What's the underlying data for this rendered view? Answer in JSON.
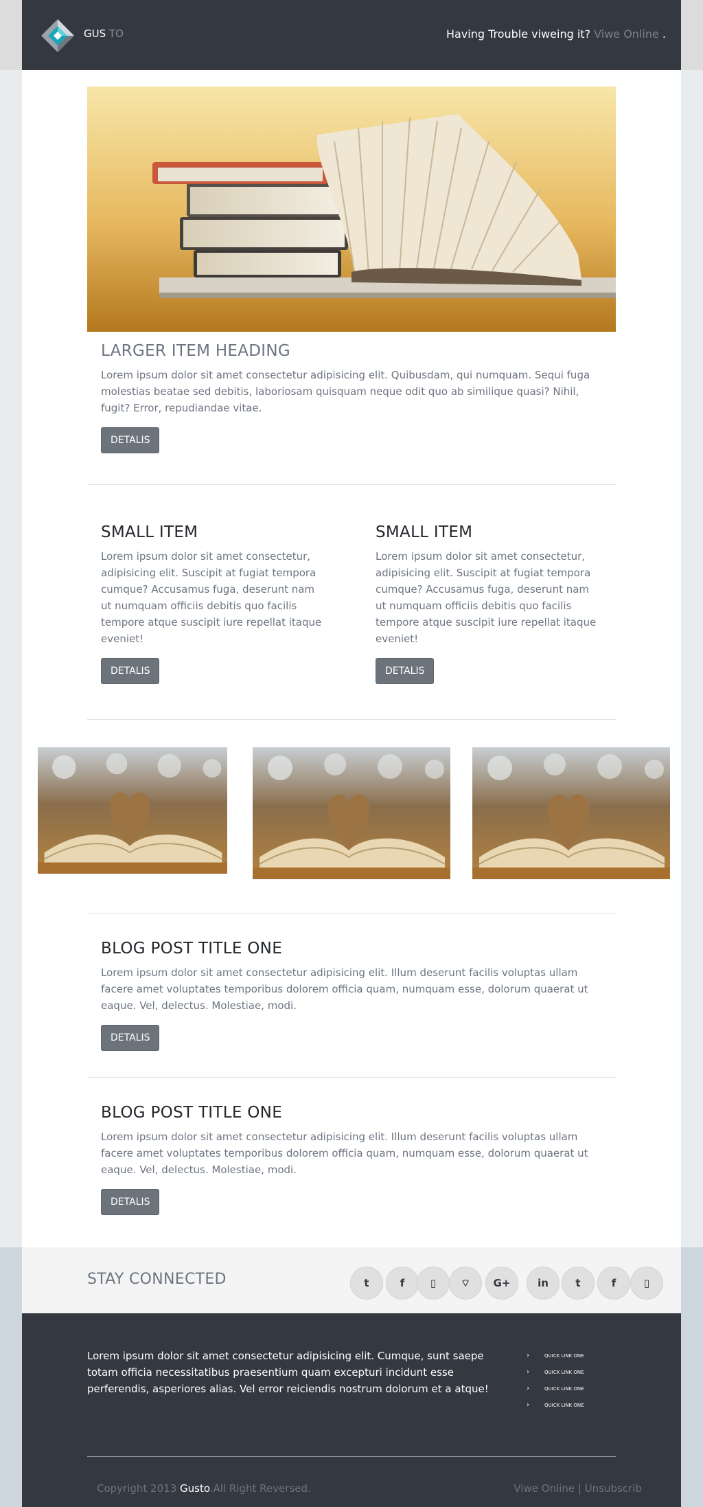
{
  "header": {
    "brand_main": "GUS",
    "brand_sub": "TO",
    "trouble_text": "Having Trouble viweing it? ",
    "view_online": "Viwe Online",
    "trouble_end": " ."
  },
  "hero": {
    "heading": "LARGER ITEM HEADING",
    "text": "Lorem ipsum dolor sit amet consectetur adipisicing elit. Quibusdam, qui numquam. Sequi fuga molestias beatae sed debitis, laboriosam quisquam neque odit quo ab similique quasi? Nihil, fugit? Error, repudiandae vitae.",
    "button": "DETALIS"
  },
  "small_items": [
    {
      "heading": "SMALL ITEM",
      "text": "Lorem ipsum dolor sit amet consectetur, adipisicing elit. Suscipit at fugiat tempora cumque? Accusamus fuga, deserunt nam ut numquam officiis debitis quo facilis tempore atque suscipit iure repellat itaque eveniet!",
      "button": "DETALIS"
    },
    {
      "heading": "SMALL ITEM",
      "text": "Lorem ipsum dolor sit amet consectetur, adipisicing elit. Suscipit at fugiat tempora cumque? Accusamus fuga, deserunt nam ut numquam officiis debitis quo facilis tempore atque suscipit iure repellat itaque eveniet!",
      "button": "DETALIS"
    }
  ],
  "blog_posts": [
    {
      "title": "BLOG POST TITLE ONE",
      "text": "Lorem ipsum dolor sit amet consectetur adipisicing elit. Illum deserunt facilis voluptas ullam facere amet voluptates temporibus dolorem officia quam, numquam esse, dolorum quaerat ut eaque. Vel, delectus. Molestiae, modi.",
      "button": "DETALIS"
    },
    {
      "title": "BLOG POST TITLE ONE",
      "text": "Lorem ipsum dolor sit amet consectetur adipisicing elit. Illum deserunt facilis voluptas ullam facere amet voluptates temporibus dolorem officia quam, numquam esse, dolorum quaerat ut eaque. Vel, delectus. Molestiae, modi.",
      "button": "DETALIS"
    }
  ],
  "stay_connected": {
    "title": "STAY CONNECTED",
    "icons": [
      "twitter-icon",
      "facebook-icon",
      "mobile-icon",
      "wifi-icon",
      "google-plus-icon",
      "linkedin-icon",
      "twitter-icon",
      "facebook-icon",
      "mobile-icon"
    ],
    "glyphs": [
      "t",
      "f",
      "▯",
      "⌔",
      "G+",
      "in",
      "t",
      "f",
      "▯"
    ]
  },
  "footer": {
    "text": "Lorem ipsum dolor sit amet consectetur adipisicing elit. Cumque, sunt saepe totam officia necessitatibus praesentium quam excepturi incidunt esse perferendis, asperiores alias. Vel error reiciendis nostrum dolorum et a atque!",
    "quick_links": [
      "QUICK LINK ONE",
      "QUICK LINK ONE",
      "QUICK LINK ONE",
      "QUICK LINK ONE"
    ],
    "copyright_pre": "Copyright 2013 ",
    "copyright_brand": "Gusto",
    "copyright_post": ".All Right Reversed.",
    "view_online": "Viwe Online",
    "separator": " | ",
    "unsubscribe": "Unsubscrib"
  },
  "colors": {
    "dark": "#343840",
    "button": "#6c737b",
    "muted_text": "#6c7480",
    "logo_accent": "#1aa6b7"
  }
}
